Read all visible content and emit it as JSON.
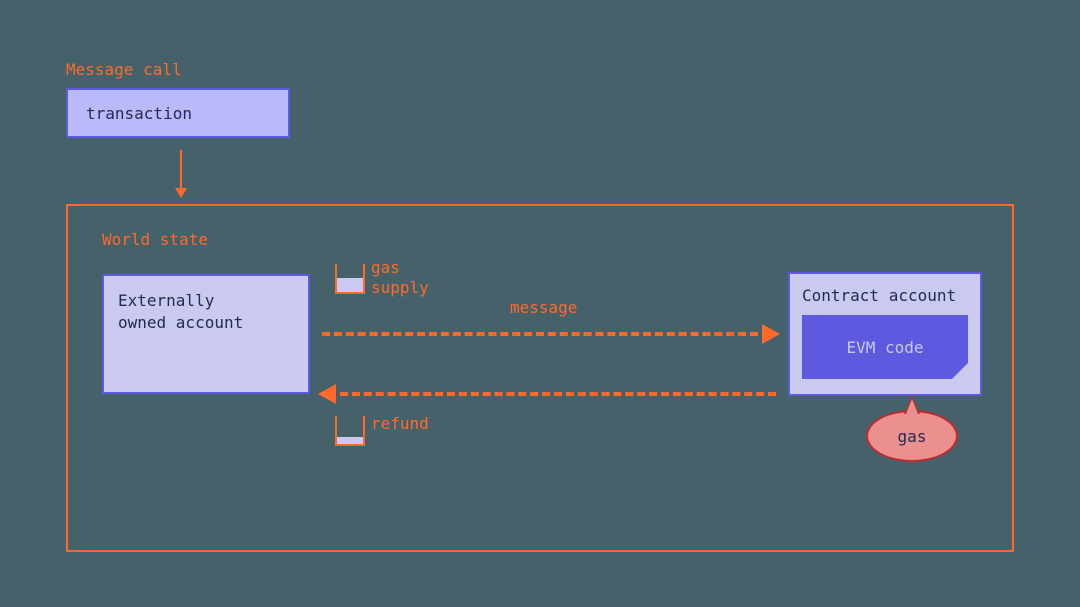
{
  "title": "Message call",
  "transaction_label": "transaction",
  "world_state": {
    "title": "World state",
    "eoa_label": "Externally\nowned account",
    "gas_supply_label": "gas\nsupply",
    "message_label": "message",
    "refund_label": "refund",
    "contract": {
      "title": "Contract account",
      "evm_label": "EVM code"
    },
    "gas_bubble_label": "gas"
  },
  "colors": {
    "background": "#45616a",
    "accent_orange": "#ff6a2b",
    "box_lavender": "#c9caed",
    "box_lavender_light": "#babafb",
    "border_indigo": "#5e5ae0",
    "bubble_fill": "#eb8f8f",
    "bubble_border": "#b82f2f"
  }
}
